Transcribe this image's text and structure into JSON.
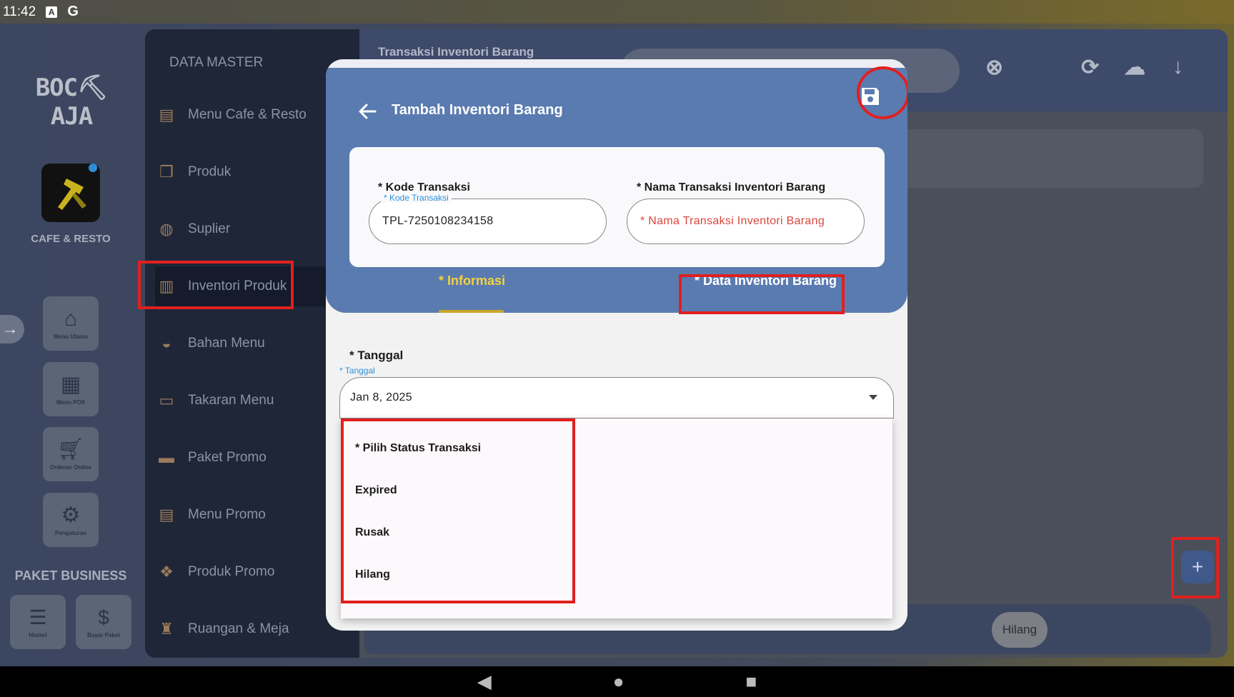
{
  "status_bar": {
    "time": "11:42",
    "icon_a": "A",
    "icon_g": "G"
  },
  "rail": {
    "logo": "BOC⛏AJA",
    "app_label": "CAFE & RESTO",
    "buttons": [
      {
        "label": "Menu Utama",
        "icon": "home-icon"
      },
      {
        "label": "Menu POS",
        "icon": "store-add-icon"
      },
      {
        "label": "Orderan Online",
        "icon": "cart-icon"
      },
      {
        "label": "Pengaturan",
        "icon": "gear-icon"
      }
    ],
    "paket_label": "PAKET BUSINESS",
    "bottom_buttons": [
      {
        "label": "Histori",
        "icon": "list-icon"
      },
      {
        "label": "Bayar Paket",
        "icon": "dollar-icon"
      }
    ]
  },
  "menu": {
    "heading": "DATA MASTER",
    "items": [
      {
        "label": "Menu Cafe & Resto"
      },
      {
        "label": "Produk"
      },
      {
        "label": "Suplier"
      },
      {
        "label": "Inventori Produk"
      },
      {
        "label": "Bahan Menu"
      },
      {
        "label": "Takaran Menu"
      },
      {
        "label": "Paket Promo"
      },
      {
        "label": "Menu Promo"
      },
      {
        "label": "Produk Promo"
      },
      {
        "label": "Ruangan & Meja"
      }
    ]
  },
  "main": {
    "title": "Transaksi Inventori Barang",
    "chip_hilang": "Hilang"
  },
  "modal": {
    "title": "Tambah Inventori Barang",
    "kode": {
      "label": "* Kode Transaksi",
      "float": "* Kode Transaksi",
      "value": "TPL-7250108234158"
    },
    "nama": {
      "label": "* Nama Transaksi Inventori Barang",
      "placeholder": "* Nama Transaksi Inventori Barang"
    },
    "tabs": {
      "informasi": "* Informasi",
      "data": "* Data Inventori Barang"
    },
    "tanggal": {
      "label": "* Tanggal",
      "float": "* Tanggal",
      "value": "Jan 8, 2025"
    },
    "status_options": [
      "* Pilih Status Transaksi",
      "Expired",
      "Rusak",
      "Hilang"
    ]
  },
  "colors": {
    "modal_header": "#5a7bb0",
    "active_tab": "#f3d23e",
    "highlight": "#e0201f",
    "float_label": "#2f8fd8",
    "placeholder": "#d9463b"
  }
}
